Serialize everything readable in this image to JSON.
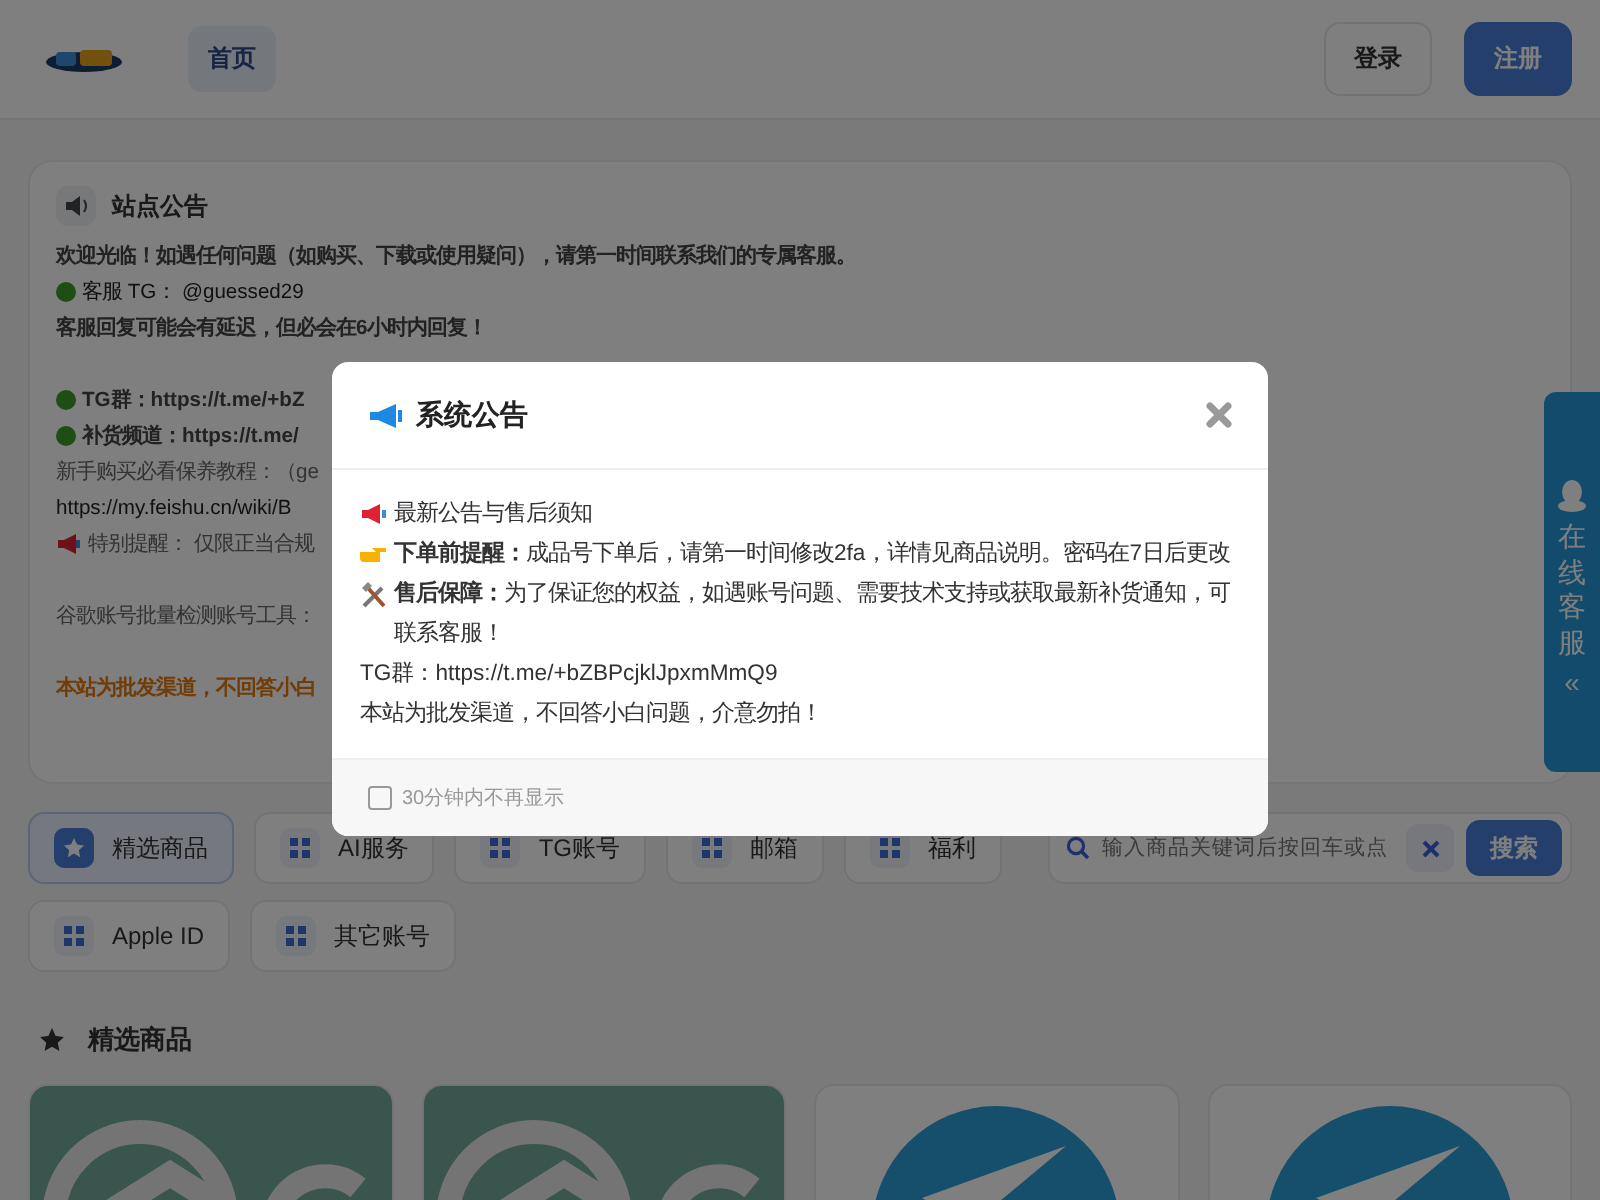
{
  "header": {
    "nav": [
      {
        "label": "首页",
        "selected": true
      }
    ],
    "buttons": [
      {
        "label": "登录",
        "kind": "outline"
      },
      {
        "label": "注册",
        "kind": "primary"
      }
    ]
  },
  "notice": {
    "title": "站点公告",
    "paragraphs": [
      [
        {
          "text": "欢迎光临！如遇任何问题（如购买、下载或使用疑问），请第一时间联系我们的专属客服。",
          "kind": "bold"
        },
        {
          "text": "客服 TG： @guessed29",
          "kind": "dot"
        },
        {
          "text": "客服回复可能会有延迟，但必会在6小时内回复！",
          "kind": "bold"
        }
      ],
      [
        {
          "text": "TG群：https://t.me/+bZ",
          "kind": "dot-bold"
        },
        {
          "text": "补货频道：https://t.me/",
          "kind": "dot-bold"
        },
        {
          "text": "新手购买必看保养教程：（ge",
          "kind": "muted"
        },
        {
          "text": "https://my.feishu.cn/wiki/B",
          "kind": "dark"
        },
        {
          "text": "特别提醒： 仅限正当合规",
          "kind": "alert"
        }
      ],
      [
        {
          "text": "谷歌账号批量检测账号工具：",
          "kind": "muted"
        }
      ],
      [
        {
          "text": "本站为批发渠道，不回答小白",
          "kind": "accent"
        }
      ]
    ]
  },
  "categories": [
    {
      "label": "精选商品",
      "selected": true,
      "kind": "star"
    },
    {
      "label": "AI服务",
      "selected": false,
      "kind": "grid"
    },
    {
      "label": "TG账号",
      "selected": false,
      "kind": "grid"
    },
    {
      "label": "邮箱",
      "selected": false,
      "kind": "grid"
    },
    {
      "label": "福利",
      "selected": false,
      "kind": "grid"
    },
    {
      "label": "Apple ID",
      "selected": false,
      "kind": "grid"
    },
    {
      "label": "其它账号",
      "selected": false,
      "kind": "grid"
    }
  ],
  "search": {
    "placeholder": "输入商品关键词后按回车或点",
    "button": "搜索"
  },
  "section": {
    "title": "精选商品"
  },
  "products": [
    {
      "kind": "knot"
    },
    {
      "kind": "knot"
    },
    {
      "kind": "plane"
    },
    {
      "kind": "plane"
    }
  ],
  "side_tab": {
    "label": "在线客服",
    "arrow": "«"
  },
  "modal": {
    "title": "系统公告",
    "lines": [
      {
        "kind": "megaphone",
        "text": "最新公告与售后须知"
      },
      {
        "kind": "hand",
        "text": "**下单前提醒：**成品号下单后，请第一时间修改2fa，详情见商品说明。密码在7日后更改"
      },
      {
        "kind": "tools",
        "text": "**售后保障：**为了保证您的权益，如遇账号问题、需要技术支持或获取最新补货通知，可联系客服！"
      },
      {
        "kind": "plain",
        "text": "TG群：https://t.me/+bZBPcjklJpxmMmQ9"
      },
      {
        "kind": "plain",
        "text": "本站为批发渠道，不回答小白问题，介意勿拍！"
      }
    ],
    "checkbox": {
      "label": "30分钟内不再显示",
      "checked": false
    }
  }
}
